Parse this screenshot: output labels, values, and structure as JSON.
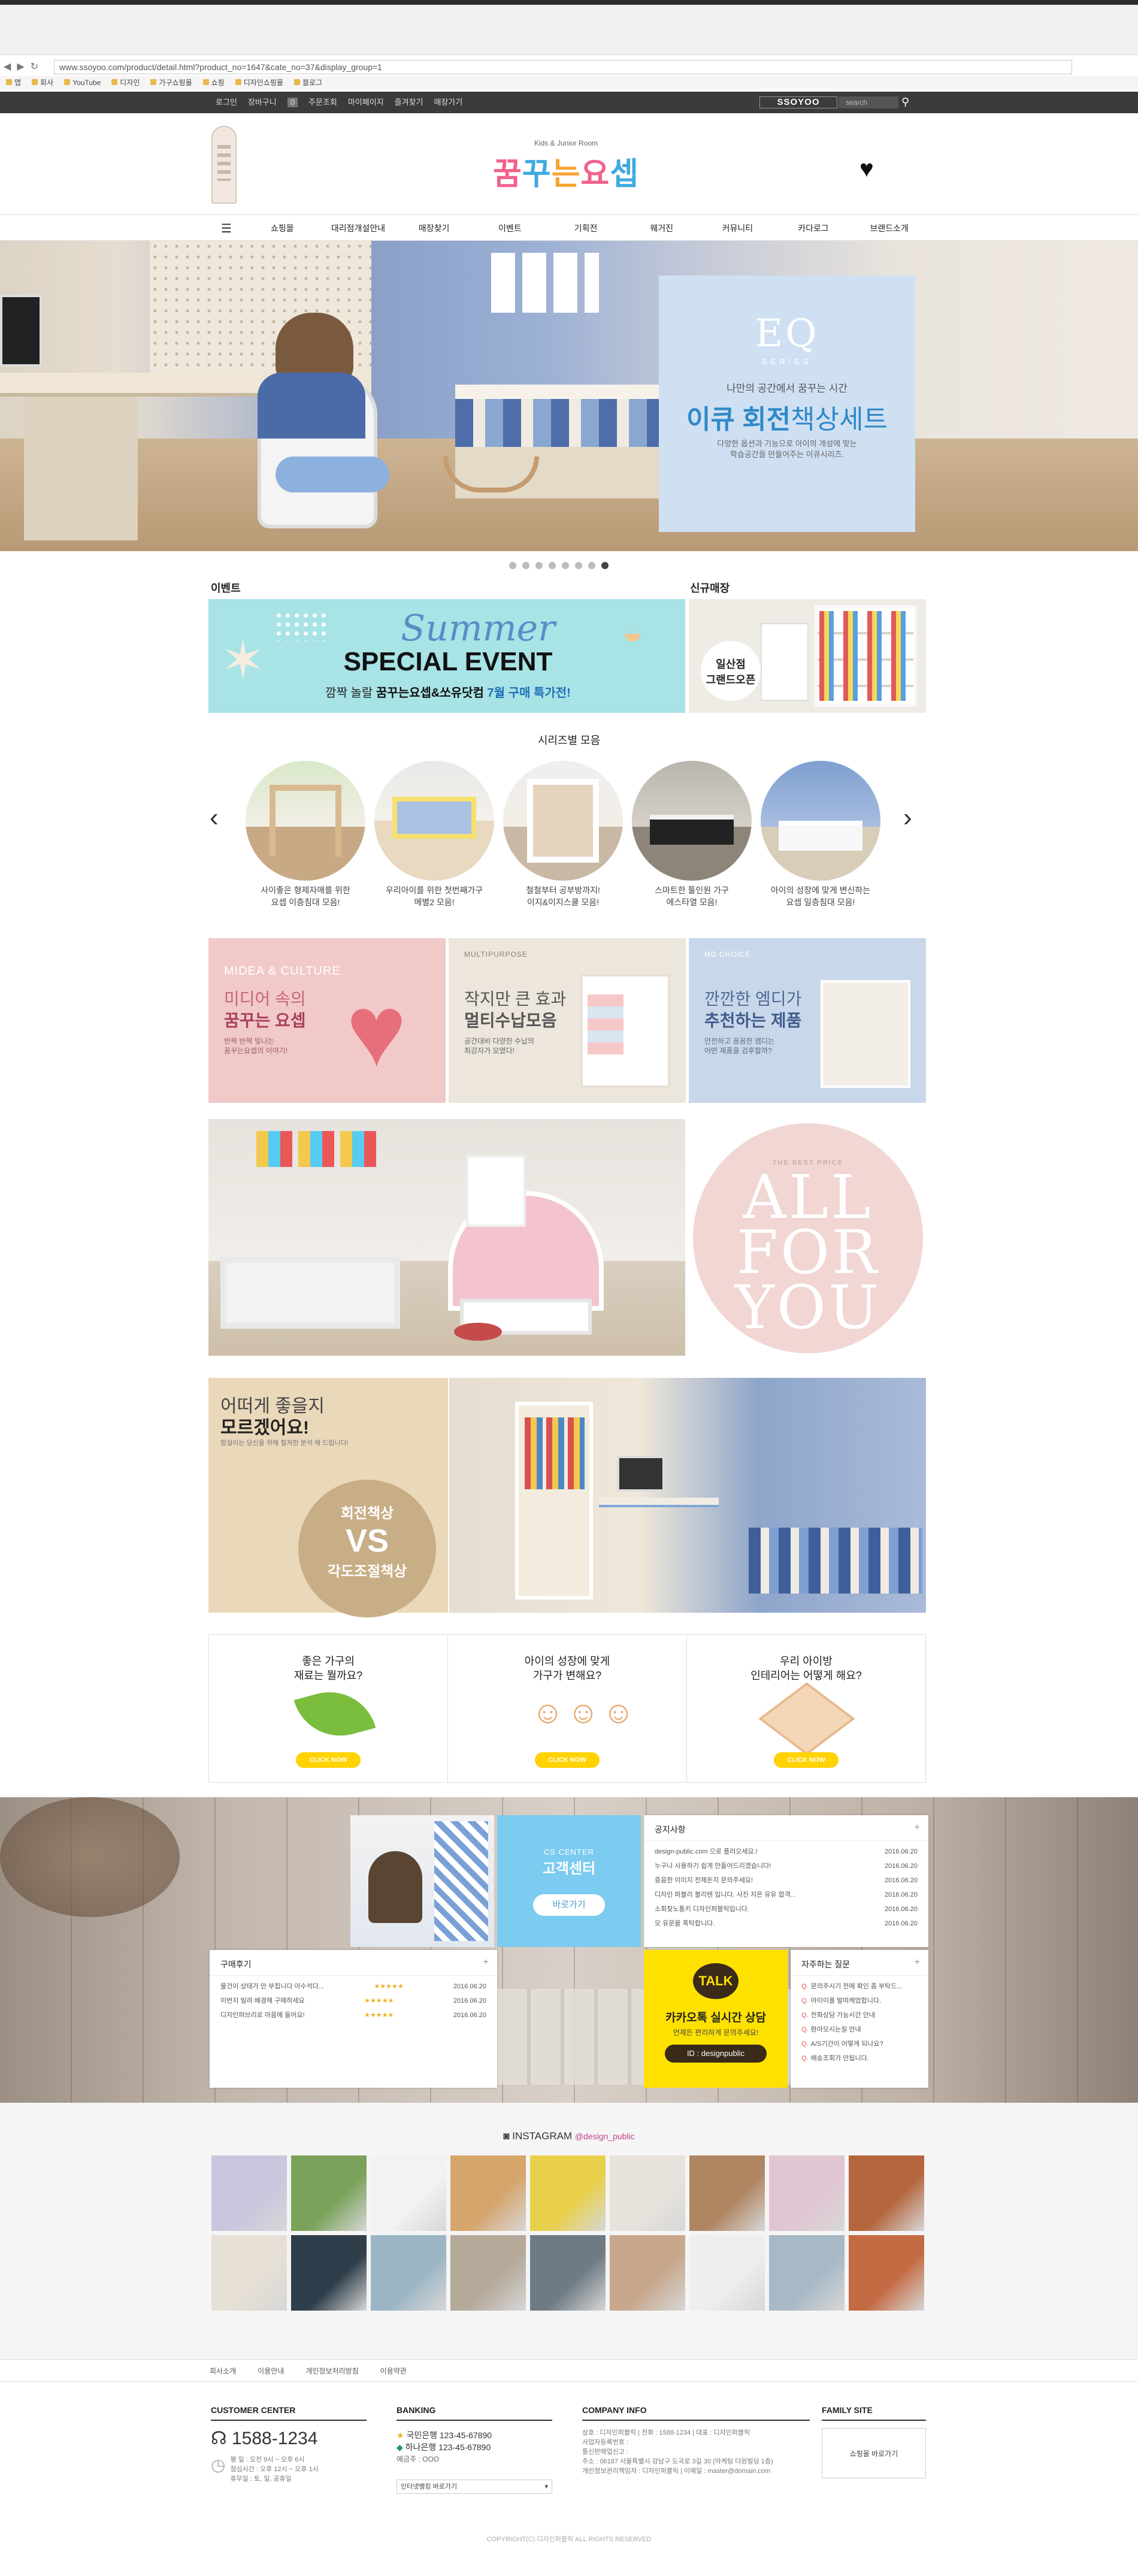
{
  "browser": {
    "url": "www.ssoyoo.com/product/detail.html?product_no=1647&cate_no=37&display_group=1",
    "nav": [
      "◀",
      "▶",
      "↻"
    ],
    "bookmarks": [
      "앱",
      "회사",
      "YouTube",
      "디자인",
      "가구쇼핑몰",
      "쇼핑",
      "디자인쇼핑몰",
      "블로그"
    ]
  },
  "topbar": {
    "util_links": [
      "로그인",
      "장바구니",
      "0",
      "주문조회",
      "마이페이지",
      "즐겨찾기",
      "매장가기"
    ],
    "brand": "SSOYOO",
    "search_placeholder": "search"
  },
  "header": {
    "logo_sub": "Kids & Junior Room",
    "logo_chars": [
      "꿈",
      "꾸",
      "는",
      "요",
      "셉"
    ]
  },
  "gnb": {
    "items": [
      "쇼핑몰",
      "대리점개설안내",
      "매장찾기",
      "이벤트",
      "기획전",
      "웨거진",
      "커뮤니티",
      "카다로그",
      "브랜드소개"
    ]
  },
  "hero": {
    "eq": "EQ",
    "eq_sub": "SERIES",
    "line1": "나만의 공간에서 꿈꾸는 시간",
    "line2_bold": "이큐 회전",
    "line2_rest": "책상세트",
    "desc1": "다양한 옵션과 기능으로 아이의 개성에 맞는",
    "desc2": "학습공간을 만들어주는 이큐시리즈.",
    "dots": 8,
    "active_dot": 7
  },
  "event": {
    "label": "이벤트",
    "summer": "Summer",
    "title": "SPECIAL EVENT",
    "sub_pre": "깜짝 놀랄",
    "sub_bold": "꿈꾸는요셉&쏘유닷컴",
    "sub_hl": "7월 구매 특가전!"
  },
  "newstore": {
    "label": "신규매장",
    "badge1": "일산점",
    "badge2": "그랜드오픈"
  },
  "series": {
    "title": "시리즈별 모음",
    "prev": "‹",
    "next": "›",
    "items": [
      {
        "cap1": "사이좋은 형제자매를 위한",
        "cap2": "요셉 이층침대 모음!"
      },
      {
        "cap1": "우리아이를 위한 첫번째가구",
        "cap2": "메별2 모음!"
      },
      {
        "cap1": "철철부터 공부방까지!",
        "cap2": "이지&이지스쿨 모음!"
      },
      {
        "cap1": "스마트한 툴인원 가구",
        "cap2": "에스타열 모음!"
      },
      {
        "cap1": "아이의 성장에 맞게 변신하는",
        "cap2": "요셉 일층침대 모음!"
      }
    ]
  },
  "categories": [
    {
      "en": "MIDEA & CULTURE",
      "ko1": "미디어 속의",
      "ko2": "꿈꾸는 요셉",
      "desc1": "반짝 반짝 빛나는",
      "desc2": "꿈꾸는요셉의 이야기!"
    },
    {
      "en": "MULTIPURPOSE",
      "ko1": "작지만 큰 효과",
      "ko2": "멀티수납모음",
      "desc1": "공간대비 다양한 수납의",
      "desc2": "최강자가 모였다!"
    },
    {
      "en": "MD CHOICE",
      "ko1": "깐깐한 엠디가",
      "ko2": "추천하는 제품",
      "desc1": "안전하고 꼼꼼한 엠디는",
      "desc2": "어떤 제품을 검후할까?"
    }
  ],
  "allfor": {
    "best": "THE BEST PRICE",
    "l1": "ALL",
    "l2": "FOR",
    "l3": "YOU"
  },
  "vs": {
    "t1": "어떠게 좋을지",
    "t2": "모르겠어요!",
    "t3": "망설이는 당신을 위해 철저한 분석 해 드립니다!",
    "c1": "회전책상",
    "c2": "VS",
    "c3": "각도조절책상"
  },
  "tips": [
    {
      "title1": "좋은 가구의",
      "title2": "재료는 뭘까요?",
      "btn": "CLICK NOW"
    },
    {
      "title1": "아이의 성장에 맞게",
      "title2": "가구가 변해요?",
      "btn": "CLICK NOW"
    },
    {
      "title1": "우리 아이방",
      "title2": "인테리어는 어떻게 해요?",
      "btn": "CLICK NOW"
    }
  ],
  "cs": {
    "en": "CS CENTER",
    "ko": "고객센터",
    "btn": "바로가기"
  },
  "notice": {
    "title": "공지사항",
    "plus": "+",
    "rows": [
      {
        "t": "design-public.com 으로 플러오세요.!",
        "d": "2016.06.20"
      },
      {
        "t": "누구나 사용하기 쉽게 만들어드리겠습니다!",
        "d": "2016.06.20"
      },
      {
        "t": "중음한 이미지 전제돈지 문의주세요!",
        "d": "2016.06.20"
      },
      {
        "t": "디자인 퍼블리 블리텐 입니다. 사진 지은 유유 합격...",
        "d": "2016.06.20"
      },
      {
        "t": "소회찾노통키 디자인퍼블릭입니다.",
        "d": "2016.06.20"
      },
      {
        "t": "모 유문을 폭탁합니다.",
        "d": "2016.06.20"
      }
    ]
  },
  "review": {
    "title": "구매후기",
    "plus": "+",
    "rows": [
      {
        "t": "물건이 상태가 안 부칩니다 아수석다...",
        "s": "★★★★★",
        "d": "2016.06.20"
      },
      {
        "t": "이번지 빌려 배경해 구매하세요",
        "s": "★★★★★",
        "d": "2016.06.20"
      },
      {
        "t": "디자인퍼브리로 마음에 들어요!",
        "s": "★★★★★",
        "d": "2016.06.20"
      }
    ]
  },
  "kakao": {
    "bubble": "TALK",
    "title": "카카오톡 실시간 상담",
    "sub": "언제든 편리하게 문의주세요!",
    "id": "ID : designpublic"
  },
  "faq": {
    "title": "자주하는 질문",
    "plus": "+",
    "rows": [
      "문의주시기 전에 확인 좀 부탁드...",
      "아이이를 발마케었합니다.",
      "전화상담 가능시간 안내",
      "환아모시는질 안내",
      "A/S기간이 어떻게 되나요?",
      "배송조회가 안됩니다."
    ]
  },
  "instagram": {
    "title": "INSTAGRAM",
    "handle": "@design_public",
    "colors": [
      "#c9c6de",
      "#7aa25a",
      "#f2f2f2",
      "#d6a56c",
      "#e8d04a",
      "#e7e3dc",
      "#b08562",
      "#e0c6d3",
      "#b5663e",
      "#e6e0d6",
      "#2e3e4a",
      "#9bb5c4",
      "#b5a99a",
      "#6f7b84",
      "#c7a88c",
      "#efeeec",
      "#a7b8c6",
      "#c46b43"
    ]
  },
  "footer": {
    "links": [
      "회사소개",
      "이용안내",
      "개인정보처리방침",
      "이용약관"
    ],
    "cs_title": "CUSTOMER CENTER",
    "phone": "1588-1234",
    "hours1": "평 일 : 오전 9시 ~ 오후 6시",
    "hours2": "점심시간 : 오후 12시 ~ 오후 1시",
    "hours3": "휴무일 : 토, 일, 공휴일",
    "bank_title": "BANKING",
    "bank1": "국민은행 123-45-67890",
    "bank2": "하나은행 123-45-67890",
    "holder": "예금주 : OOO",
    "bank_select": "인터넷뱅킹 바로가기",
    "company_title": "COMPANY INFO",
    "c1": "상호 : 디자인퍼블릭 | 전화 : 1588-1234 | 대표 : 디자인퍼블릭",
    "c2": "사업자등록번호 :",
    "c3": "통신판매업신고 :",
    "c4": "주소 : 06187 서울특별시 강남구 도곡로 3길 30 (마케팅 더원빌딩 1층)",
    "c5": "개인정보관리책임자 : 디자인퍼블릭 | 이메일 : master@domain.com",
    "family_title": "FAMILY SITE",
    "family_btn": "쇼핑몰 바로가기",
    "copyright": "COPYRIGHT(C) 디자인퍼블릭 ALL RIGHTS RESERVED"
  }
}
